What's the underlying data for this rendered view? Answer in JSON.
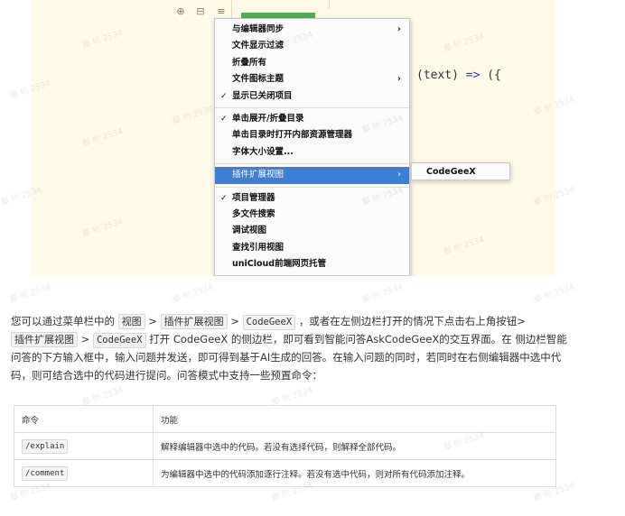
{
  "screenshot": {
    "toolbar_icons": [
      "target-icon",
      "collapse-icon",
      "menu-icon"
    ],
    "code": {
      "text": "(text) ",
      "arrow": "=>",
      "rest": " ({"
    },
    "menu": {
      "items": [
        {
          "label": "与编辑器同步",
          "check": "",
          "submenu": "›"
        },
        {
          "label": "文件显示过滤",
          "check": "",
          "submenu": ""
        },
        {
          "label": "折叠所有",
          "check": "",
          "submenu": ""
        },
        {
          "label": "文件图标主题",
          "check": "",
          "submenu": "›"
        },
        {
          "label": "显示已关闭项目",
          "check": "✓",
          "submenu": ""
        },
        {
          "label": "单击展开/折叠目录",
          "check": "✓",
          "submenu": ""
        },
        {
          "label": "单击目录时打开内部资源管理器",
          "check": "",
          "submenu": ""
        },
        {
          "label": "字体大小设置...",
          "check": "",
          "submenu": ""
        },
        {
          "label": "插件扩展视图",
          "check": "",
          "submenu": "›"
        },
        {
          "label": "项目管理器",
          "check": "✓",
          "submenu": ""
        },
        {
          "label": "多文件搜索",
          "check": "",
          "submenu": ""
        },
        {
          "label": "调试视图",
          "check": "",
          "submenu": ""
        },
        {
          "label": "查找引用视图",
          "check": "",
          "submenu": ""
        },
        {
          "label": "uniCloud前端网页托管",
          "check": "",
          "submenu": ""
        }
      ],
      "submenu_item": "CodeGeeX"
    }
  },
  "paragraph": {
    "p1": "您可以通过菜单栏中的 ",
    "k1": "视图",
    "s1": " > ",
    "k2": "插件扩展视图",
    "s2": " > ",
    "k3": "CodeGeeX",
    "p2": " ，或者在左侧边栏打开的情况下点击右上角按钮> ",
    "k4": "插件扩展视图",
    "s3": " > ",
    "k5": "CodeGeeX",
    "p3": " 打开 CodeGeeX 的侧边栏，即可看到智能问答AskCodeGeeX的交互界面。在 侧边栏智能问答的下方输入框中，输入问题并发送，即可得到基于AI生成的回答。在输入问题的同时，若同时在右侧编辑器中选中代码，则可结合选中的代码进行提问。问答模式中支持一些预置命令："
  },
  "table": {
    "headers": [
      "命令",
      "功能"
    ],
    "rows": [
      {
        "cmd": "/explain",
        "desc": "解释编辑器中选中的代码。若没有选择代码，则解释全部代码。"
      },
      {
        "cmd": "/comment",
        "desc": "为编辑器中选中的代码添加逐行注释。若没有选中代码，则对所有代码添加注释。"
      }
    ]
  },
  "watermark": "鄙 桁 2534"
}
